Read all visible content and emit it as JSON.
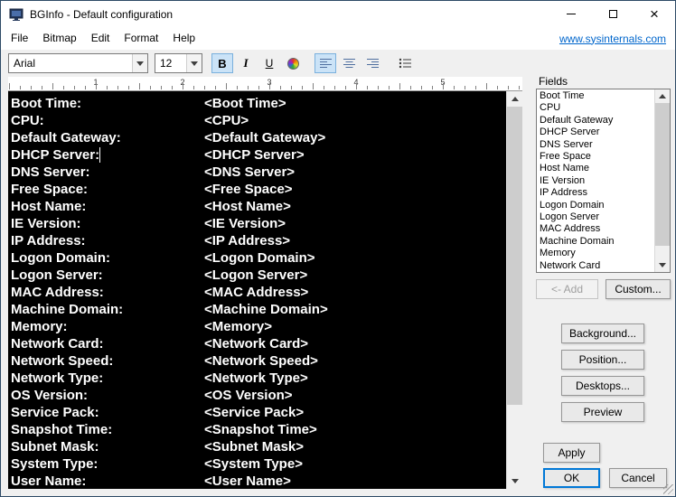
{
  "window": {
    "title": "BGInfo - Default configuration"
  },
  "menu": {
    "items": [
      "File",
      "Bitmap",
      "Edit",
      "Format",
      "Help"
    ],
    "link": "www.sysinternals.com"
  },
  "toolbar": {
    "font": "Arial",
    "size": "12",
    "icons": [
      "bold",
      "italic",
      "underline",
      "color-wheel",
      "align-left",
      "align-center",
      "align-right",
      "bullets"
    ]
  },
  "ruler": {
    "numbers": [
      "1",
      "2",
      "3",
      "4",
      "5"
    ]
  },
  "editor": {
    "caret_after_label": "DHCP Server:",
    "lines": [
      {
        "label": "Boot Time:",
        "value": "<Boot Time>"
      },
      {
        "label": "CPU:",
        "value": "<CPU>"
      },
      {
        "label": "Default Gateway:",
        "value": "<Default Gateway>"
      },
      {
        "label": "DHCP Server:",
        "value": "<DHCP Server>"
      },
      {
        "label": "DNS Server:",
        "value": "<DNS Server>"
      },
      {
        "label": "Free Space:",
        "value": "<Free Space>"
      },
      {
        "label": "Host Name:",
        "value": "<Host Name>"
      },
      {
        "label": "IE Version:",
        "value": "<IE Version>"
      },
      {
        "label": "IP Address:",
        "value": "<IP Address>"
      },
      {
        "label": "Logon Domain:",
        "value": "<Logon Domain>"
      },
      {
        "label": "Logon Server:",
        "value": "<Logon Server>"
      },
      {
        "label": "MAC Address:",
        "value": "<MAC Address>"
      },
      {
        "label": "Machine Domain:",
        "value": "<Machine Domain>"
      },
      {
        "label": "Memory:",
        "value": "<Memory>"
      },
      {
        "label": "Network Card:",
        "value": "<Network Card>"
      },
      {
        "label": "Network Speed:",
        "value": "<Network Speed>"
      },
      {
        "label": "Network Type:",
        "value": "<Network Type>"
      },
      {
        "label": "OS Version:",
        "value": "<OS Version>"
      },
      {
        "label": "Service Pack:",
        "value": "<Service Pack>"
      },
      {
        "label": "Snapshot Time:",
        "value": "<Snapshot Time>"
      },
      {
        "label": "Subnet Mask:",
        "value": "<Subnet Mask>"
      },
      {
        "label": "System Type:",
        "value": "<System Type>"
      },
      {
        "label": "User Name:",
        "value": "<User Name>"
      }
    ]
  },
  "fields_panel": {
    "label": "Fields",
    "items": [
      "Boot Time",
      "CPU",
      "Default Gateway",
      "DHCP Server",
      "DNS Server",
      "Free Space",
      "Host Name",
      "IE Version",
      "IP Address",
      "Logon Domain",
      "Logon Server",
      "MAC Address",
      "Machine Domain",
      "Memory",
      "Network Card"
    ],
    "add_label": "<- Add",
    "custom_label": "Custom..."
  },
  "side_buttons": {
    "background": "Background...",
    "position": "Position...",
    "desktops": "Desktops...",
    "preview": "Preview"
  },
  "action_buttons": {
    "apply": "Apply",
    "ok": "OK",
    "cancel": "Cancel"
  },
  "icons": {
    "close": "×"
  },
  "colors": {
    "accent": "#0078d7",
    "editor_bg": "#000000",
    "editor_fg": "#ffffff",
    "link": "#0066cc"
  }
}
